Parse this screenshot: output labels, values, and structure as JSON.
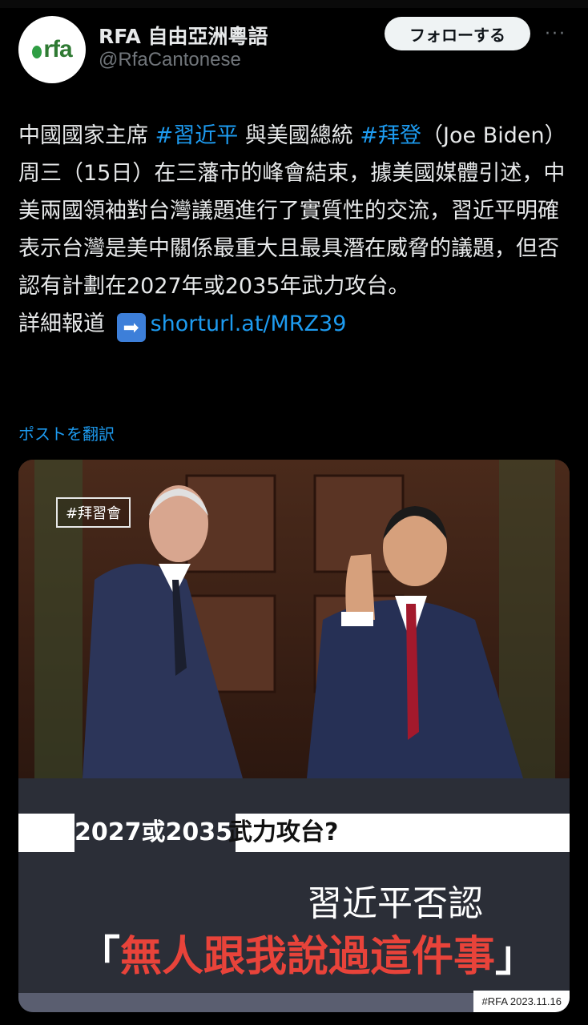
{
  "account": {
    "name": "RFA 自由亞洲粵語",
    "handle": "@RfaCantonese",
    "avatar_logo": "rfa"
  },
  "actions": {
    "follow": "フォローする",
    "more": "···"
  },
  "post": {
    "seg1": "中國國家主席 ",
    "tag1": "#習近平",
    "seg2": " 與美國總統 ",
    "tag2": "#拜登",
    "seg3": "（Joe Biden）周三（15日）在三藩市的峰會結束，據美國媒體引述，中美兩國領袖對台灣議題進行了實質性的交流，習近平明確表示台灣是美中關係最重大且最具潛在威脅的議題，但否認有計劃在2027年或2035年武力攻台。",
    "details_label": "詳細報道 ",
    "arrow_icon": "➡",
    "link": "shorturl.at/MRZ39"
  },
  "translate_label": "ポストを翻訳",
  "media": {
    "badge": "#拜習會",
    "headline_year": "2027或2035",
    "headline_q": "武力攻台?",
    "subhead": "習近平否認",
    "quote_open": "「",
    "quote_text": "無人跟我說過這件事",
    "quote_close": "」",
    "credit": "#RFA  2023.11.16"
  },
  "colors": {
    "accent": "#1d9bf0",
    "quote_red": "#e8433a"
  }
}
